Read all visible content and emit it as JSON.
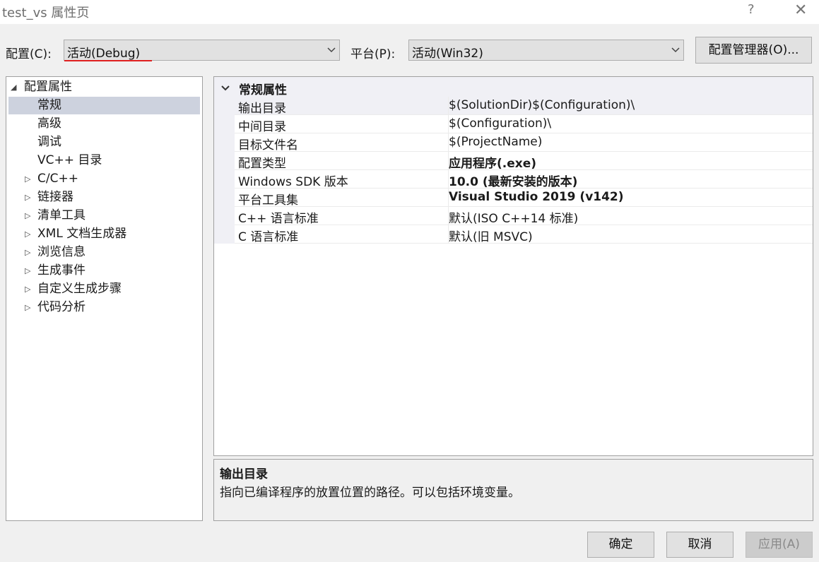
{
  "window": {
    "title": "test_vs 属性页",
    "help": "?",
    "close": "✕"
  },
  "config": {
    "label": "配置(C):",
    "value": "活动(Debug)",
    "platform_label": "平台(P):",
    "platform_value": "活动(Win32)",
    "manager_button": "配置管理器(O)...",
    "accent_color": "#e02020"
  },
  "tree": {
    "root": "配置属性",
    "items": [
      {
        "label": "常规",
        "expandable": false,
        "selected": true
      },
      {
        "label": "高级",
        "expandable": false
      },
      {
        "label": "调试",
        "expandable": false
      },
      {
        "label": "VC++ 目录",
        "expandable": false
      },
      {
        "label": "C/C++",
        "expandable": true
      },
      {
        "label": "链接器",
        "expandable": true
      },
      {
        "label": "清单工具",
        "expandable": true
      },
      {
        "label": "XML 文档生成器",
        "expandable": true
      },
      {
        "label": "浏览信息",
        "expandable": true
      },
      {
        "label": "生成事件",
        "expandable": true
      },
      {
        "label": "自定义生成步骤",
        "expandable": true
      },
      {
        "label": "代码分析",
        "expandable": true
      }
    ]
  },
  "grid": {
    "category": "常规属性",
    "rows": [
      {
        "name": "输出目录",
        "value": "$(SolutionDir)$(Configuration)\\",
        "bold": false,
        "selected": true
      },
      {
        "name": "中间目录",
        "value": "$(Configuration)\\",
        "bold": false
      },
      {
        "name": "目标文件名",
        "value": "$(ProjectName)",
        "bold": false
      },
      {
        "name": "配置类型",
        "value": "应用程序(.exe)",
        "bold": true
      },
      {
        "name": "Windows SDK 版本",
        "value": "10.0 (最新安装的版本)",
        "bold": true
      },
      {
        "name": "平台工具集",
        "value": "Visual Studio 2019 (v142)",
        "bold": true
      },
      {
        "name": "C++ 语言标准",
        "value": "默认(ISO C++14 标准)",
        "bold": false
      },
      {
        "name": "C 语言标准",
        "value": "默认(旧 MSVC)",
        "bold": false
      }
    ]
  },
  "description": {
    "title": "输出目录",
    "text": "指向已编译程序的放置位置的路径。可以包括环境变量。"
  },
  "buttons": {
    "ok": "确定",
    "cancel": "取消",
    "apply": "应用(A)"
  }
}
